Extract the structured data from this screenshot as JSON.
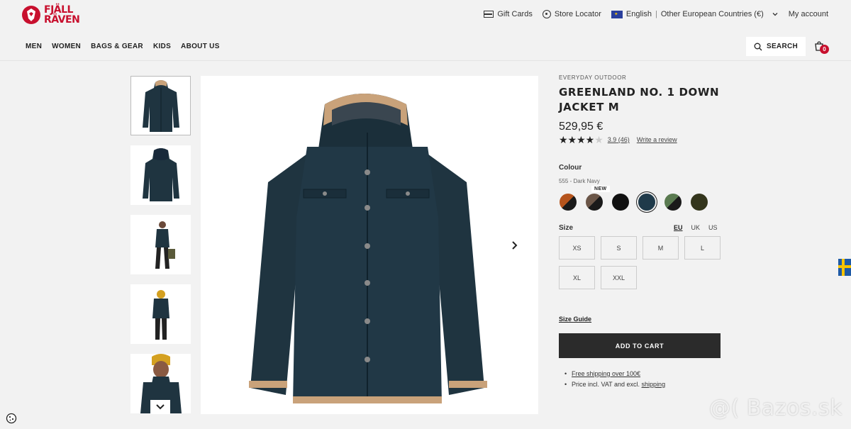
{
  "brand": {
    "logo_line1": "FJÄLL",
    "logo_line2": "RÄVEN"
  },
  "utility": {
    "gift_cards": "Gift Cards",
    "store_locator": "Store Locator",
    "language": "English",
    "separator": "|",
    "region": "Other European Countries (€)",
    "account": "My account"
  },
  "nav": [
    "MEN",
    "WOMEN",
    "BAGS & GEAR",
    "KIDS",
    "ABOUT US"
  ],
  "search": {
    "label": "SEARCH"
  },
  "cart": {
    "count": "0"
  },
  "product": {
    "category": "EVERYDAY OUTDOOR",
    "title_line1": "GREENLAND NO. 1 DOWN",
    "title_line2": "JACKET M",
    "price": "529,95 €",
    "rating_value": 3.9,
    "rating_text": "3.9",
    "reviews_count": "(46)",
    "write_review": "Write a review",
    "colour_label": "Colour",
    "colour_value": "555 - Dark Navy",
    "new_badge": "NEW",
    "swatches": [
      {
        "name": "orange-black",
        "a": "#b5541c",
        "b": "#1a1a1a"
      },
      {
        "name": "brown-black",
        "a": "#6b5648",
        "b": "#1a1a1a"
      },
      {
        "name": "black",
        "a": "#111111",
        "b": "#111111"
      },
      {
        "name": "dark-navy",
        "a": "#1f3a4a",
        "b": "#1f3a4a"
      },
      {
        "name": "green-black",
        "a": "#5a7a50",
        "b": "#1a1a1a"
      },
      {
        "name": "dark-olive",
        "a": "#33351c",
        "b": "#33351c"
      }
    ],
    "size_label": "Size",
    "size_systems": [
      "EU",
      "UK",
      "US"
    ],
    "sizes": [
      "XS",
      "S",
      "M",
      "L",
      "XL",
      "XXL"
    ],
    "size_guide": "Size Guide",
    "add_to_cart": "ADD TO CART",
    "bullet_free_shipping": "Free shipping over 100€",
    "bullet_price_prefix": "Price incl. VAT and excl. ",
    "bullet_price_link": "shipping"
  },
  "watermark": "@( Bazos.sk",
  "colors": {
    "brand_red": "#c8102e",
    "jacket": "#1f3440",
    "button": "#2b2b2b"
  }
}
